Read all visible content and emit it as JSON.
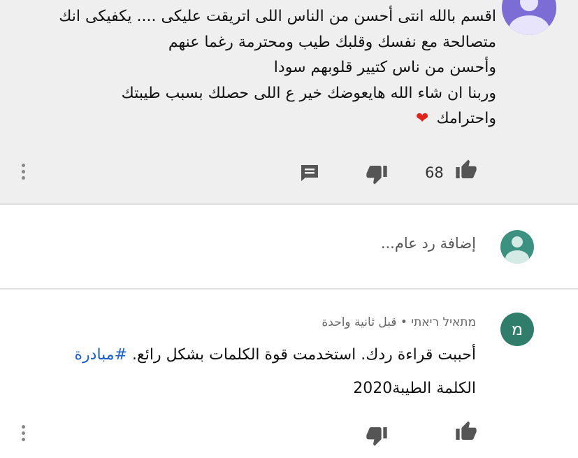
{
  "comment_1": {
    "lines": [
      "اقسم بالله انتى أحسن من الناس اللى اتريقت عليكى .... يكفيكى انك",
      "متصالحة مع نفسك وقلبك طيب ومحترمة رغما عنهم",
      "وأحسن من ناس كتيير قلوبهم سودا",
      "وربنا ان شاء الله هايعوضك خير ع اللى حصلك بسبب طيبتك",
      "واحترامك"
    ],
    "heart_emoji": "❤",
    "like_count": "68",
    "accent_bg": "#efefef"
  },
  "reply_box": {
    "placeholder": "إضافة رد عام...",
    "avatar_color": "#3d9181"
  },
  "comment_2": {
    "avatar_letter": "מ",
    "avatar_color": "#2f7d6a",
    "author": "מתאיל ריאתי",
    "separator": "•",
    "time": "قبل ثانية واحدة",
    "text_part1": "أحببت قراءة ردك. استخدمت قوة الكلمات بشكل رائع.",
    "hashtag": "#مبادرة",
    "text_part2": "الكلمة الطيبة2020"
  },
  "icons": {
    "like": "thumbs-up-icon",
    "dislike": "thumbs-down-icon",
    "reply": "comment-icon",
    "more": "more-vert-icon"
  },
  "colors": {
    "hashtag_link": "#1a5ec7",
    "avatar_purple": "#7b6cd6"
  }
}
